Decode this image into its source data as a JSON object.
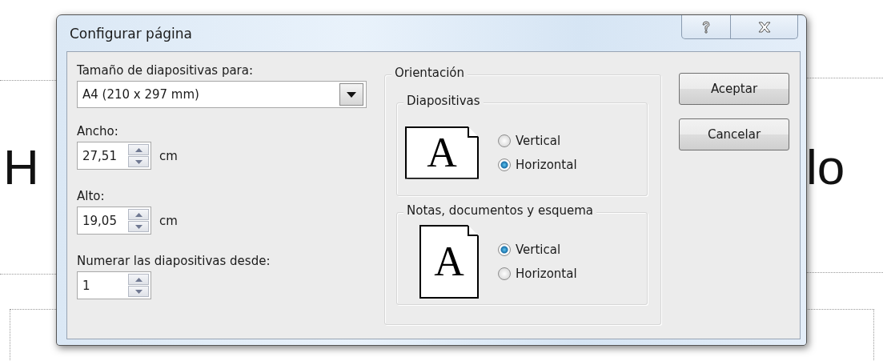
{
  "slide": {
    "title_left": "H",
    "title_right": "lo"
  },
  "dialog": {
    "title": "Configurar página",
    "title_buttons": [
      {
        "kind": "help"
      },
      {
        "kind": "close"
      }
    ],
    "size": {
      "label": "Tamaño de diapositivas para:",
      "value": "A4 (210 x 297 mm)"
    },
    "spinners": [
      {
        "label": "Ancho:",
        "value": "27,51",
        "unit": "cm"
      },
      {
        "label": "Alto:",
        "value": "19,05",
        "unit": "cm"
      },
      {
        "label": "Numerar las diapositivas desde:",
        "value": "1"
      }
    ],
    "orientation": {
      "title": "Orientación",
      "groups": [
        {
          "title": "Diapositivas",
          "kind": "landscape",
          "glyph": "A",
          "options": [
            {
              "label": "Vertical",
              "selected": false
            },
            {
              "label": "Horizontal",
              "selected": true
            }
          ]
        },
        {
          "title": "Notas, documentos y esquema",
          "kind": "portrait",
          "glyph": "A",
          "options": [
            {
              "label": "Vertical",
              "selected": true
            },
            {
              "label": "Horizontal",
              "selected": false
            }
          ]
        }
      ]
    },
    "buttons": [
      {
        "label": "Aceptar"
      },
      {
        "label": "Cancelar"
      }
    ]
  }
}
